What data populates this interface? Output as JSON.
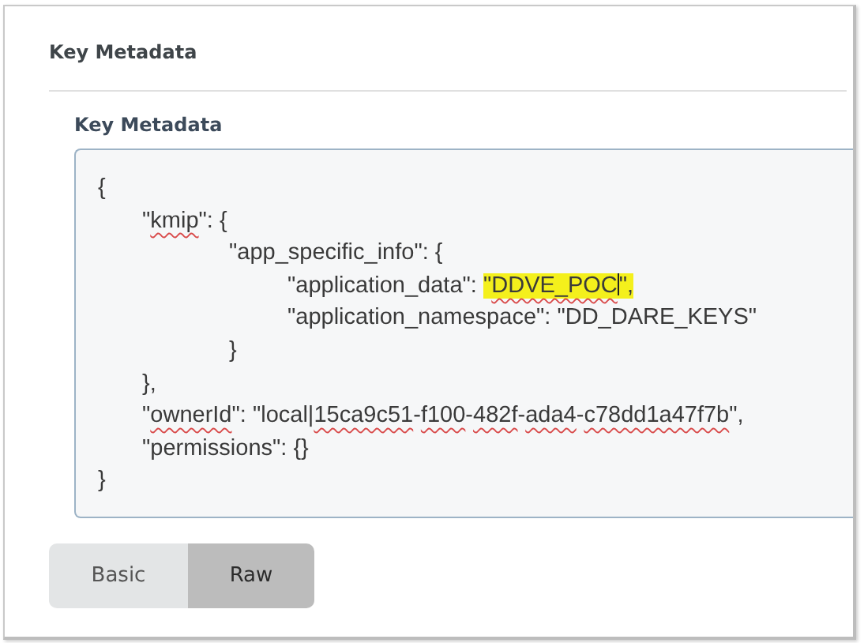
{
  "panel": {
    "title": "Key Metadata"
  },
  "field": {
    "label": "Key Metadata",
    "lines": [
      {
        "parts": [
          {
            "text": "{"
          }
        ],
        "children": [
          {
            "parts": [
              {
                "text": "\""
              },
              {
                "text": "kmip",
                "misspelled": true
              },
              {
                "text": "\": {"
              }
            ],
            "children": [
              {
                "parts": [
                  {
                    "text": "\"app_specific_info\": {"
                  }
                ],
                "children": [
                  {
                    "parts": [
                      {
                        "text": "\"application_data\": "
                      },
                      {
                        "text": "\"",
                        "highlighted": true
                      },
                      {
                        "text": "DDVE_POC",
                        "highlighted": true,
                        "misspelled": true,
                        "cursor": true
                      },
                      {
                        "text": "\",",
                        "highlighted": true
                      }
                    ]
                  },
                  {
                    "parts": [
                      {
                        "text": "\"application_namespace\": \"DD_DARE_KEYS\""
                      }
                    ]
                  }
                ]
              },
              {
                "parts": [
                  {
                    "text": "}"
                  }
                ]
              }
            ]
          },
          {
            "parts": [
              {
                "text": "},"
              }
            ]
          },
          {
            "parts": [
              {
                "text": "\""
              },
              {
                "text": "ownerId",
                "misspelled": true
              },
              {
                "text": "\": \"local|"
              },
              {
                "text": "15ca9c51",
                "misspelled": true
              },
              {
                "text": "-"
              },
              {
                "text": "f100",
                "misspelled": true
              },
              {
                "text": "-"
              },
              {
                "text": "482f",
                "misspelled": true
              },
              {
                "text": "-"
              },
              {
                "text": "ada4",
                "misspelled": true
              },
              {
                "text": "-"
              },
              {
                "text": "c78dd1a47f7b",
                "misspelled": true
              },
              {
                "text": "\","
              }
            ]
          },
          {
            "parts": [
              {
                "text": "\"permissions\": {}"
              }
            ]
          }
        ]
      },
      {
        "parts": [
          {
            "text": "}"
          }
        ]
      }
    ]
  },
  "mode_tabs": [
    {
      "label": "Basic",
      "selected": false
    },
    {
      "label": "Raw",
      "selected": true
    }
  ]
}
